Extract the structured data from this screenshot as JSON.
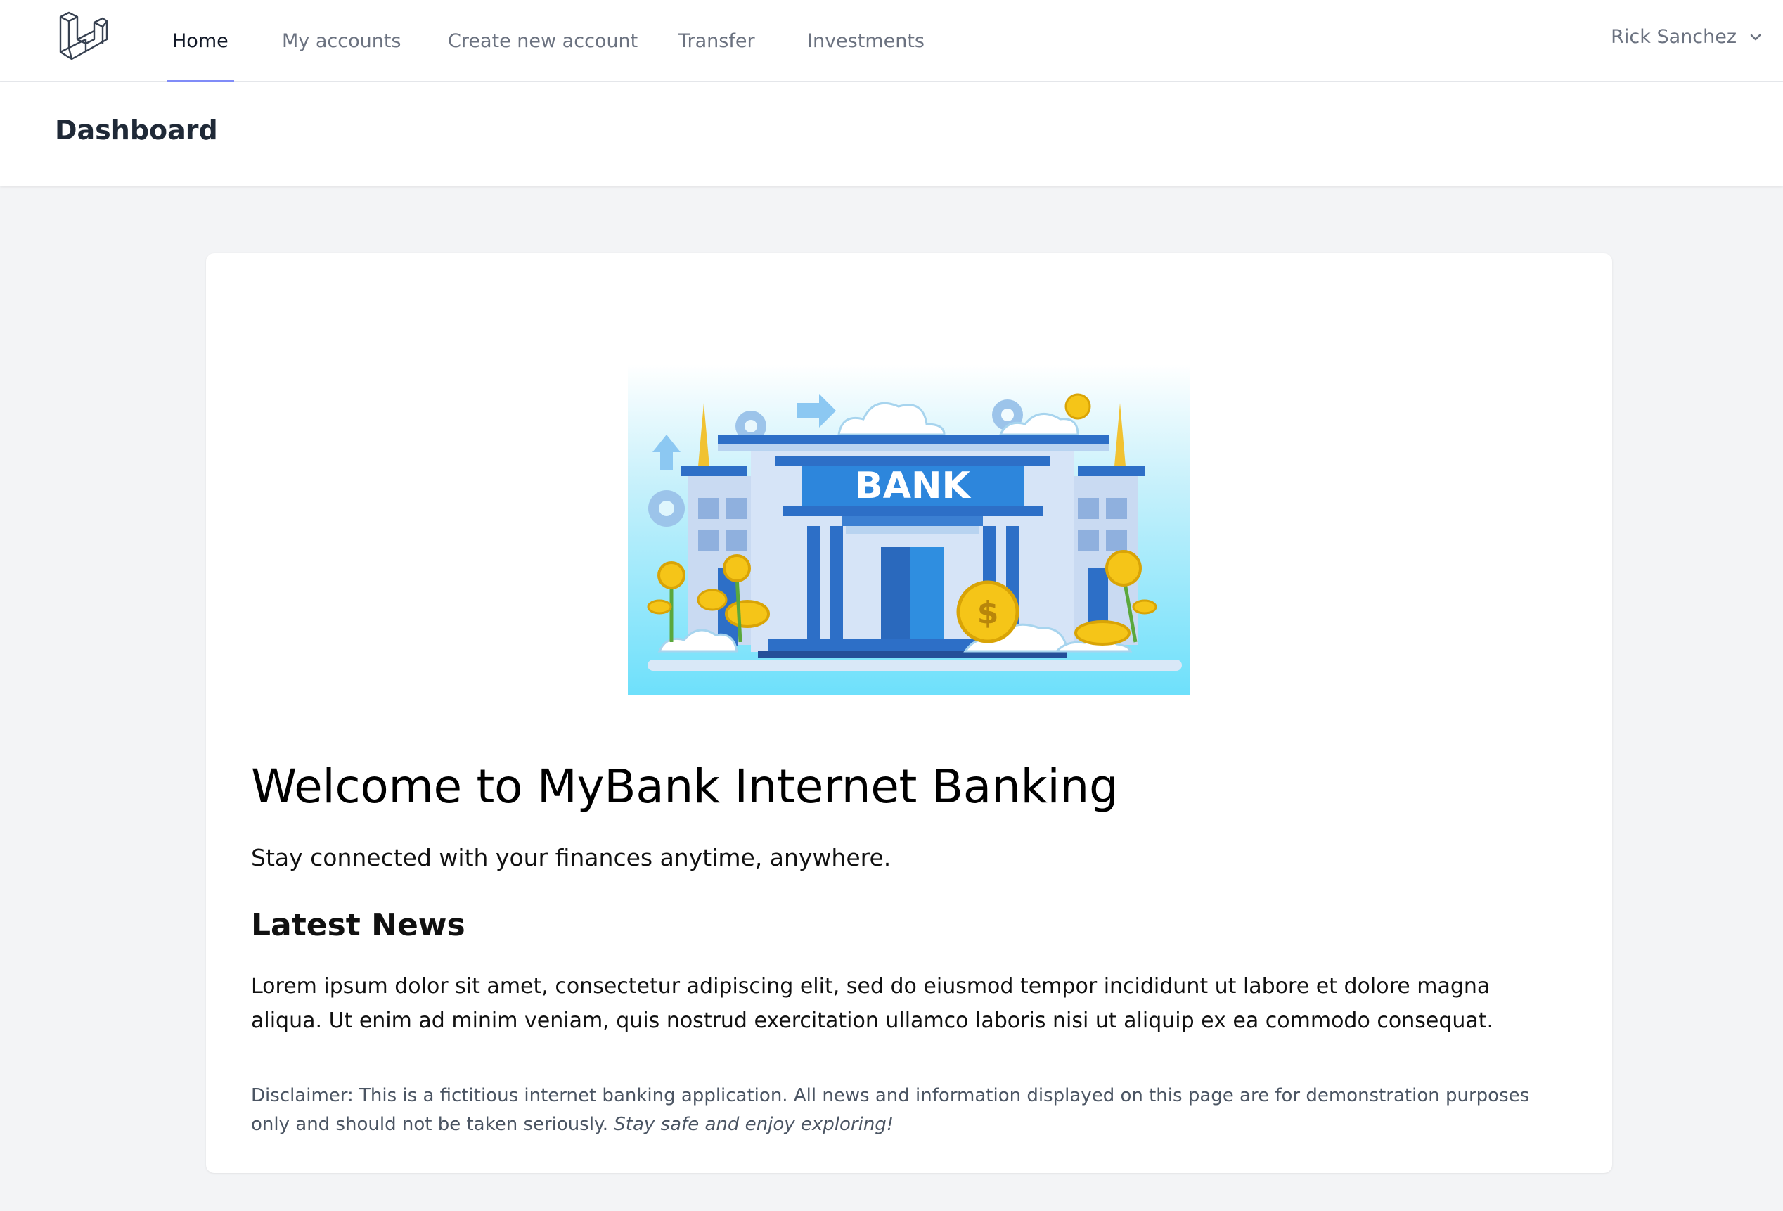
{
  "nav": {
    "logo_icon": "laravel-logo-icon",
    "items": [
      {
        "label": "Home",
        "active": true
      },
      {
        "label": "My accounts",
        "active": false
      },
      {
        "label": "Create new account",
        "active": false
      },
      {
        "label": "Transfer",
        "active": false
      },
      {
        "label": "Investments",
        "active": false
      }
    ],
    "user_name": "Rick Sanchez",
    "user_menu_icon": "chevron-down-icon"
  },
  "header": {
    "title": "Dashboard"
  },
  "main": {
    "hero_image": {
      "label": "BANK",
      "icon": "bank-illustration"
    },
    "welcome_title": "Welcome to MyBank Internet Banking",
    "tagline": "Stay connected with your finances anytime, anywhere.",
    "news_heading": "Latest News",
    "news_body": "Lorem ipsum dolor sit amet, consectetur adipiscing elit, sed do eiusmod tempor incididunt ut labore et dolore magna aliqua. Ut enim ad minim veniam, quis nostrud exercitation ullamco laboris nisi ut aliquip ex ea commodo consequat.",
    "disclaimer": "Disclaimer: This is a fictitious internet banking application. All news and information displayed on this page are for demonstration purposes only and should not be taken seriously.",
    "disclaimer_emphasis": "Stay safe and enjoy exploring!"
  },
  "colors": {
    "accent_underline": "#818cf8",
    "page_background": "#f3f4f6",
    "bank_blue": "#2d79d6",
    "coin_gold": "#f5c518"
  }
}
